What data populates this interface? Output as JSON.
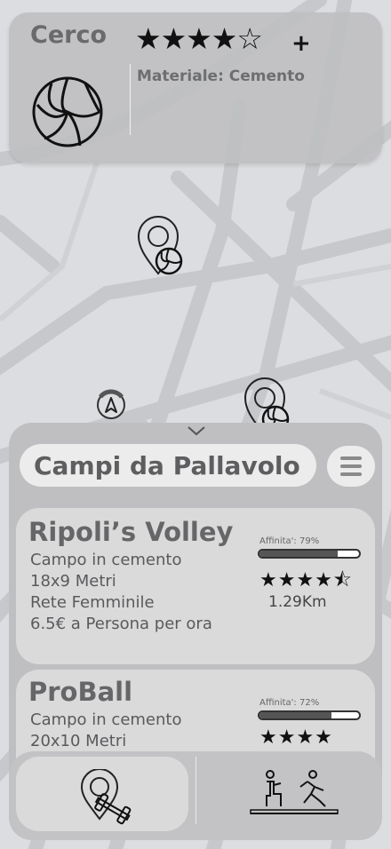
{
  "top_card": {
    "title": "Cerco",
    "rating_stars": "★★★★☆",
    "rating_plus": "+",
    "material": "Materiale: Cemento",
    "ball_icon": "volleyball-icon"
  },
  "map": {
    "pins": [
      "volleyball-pin-icon",
      "volleyball-pin-icon"
    ],
    "location_icon": "compass-arrow-icon"
  },
  "panel": {
    "collapse_icon": "chevron-down-icon",
    "search_title": "Campi da Pallavolo",
    "menu_icon": "hamburger-icon",
    "courts": [
      {
        "name": "Ripoli’s Volley",
        "lines": [
          "Campo in cemento",
          "18x9 Metri",
          "Rete Femminile",
          "6.5€ a Persona per ora"
        ],
        "affinity_label": "Affinita': 79%",
        "affinity": 79,
        "stars": "★★★★⯪",
        "distance": "1.29Km"
      },
      {
        "name": "ProBall",
        "lines": [
          "Campo in cemento",
          "20x10 Metri"
        ],
        "affinity_label": "Affinita': 72%",
        "affinity": 72,
        "stars": "★★★★"
      }
    ]
  },
  "bottom_nav": {
    "left_icon": "pin-dumbbell-icon",
    "right_icon": "athletes-icon"
  }
}
